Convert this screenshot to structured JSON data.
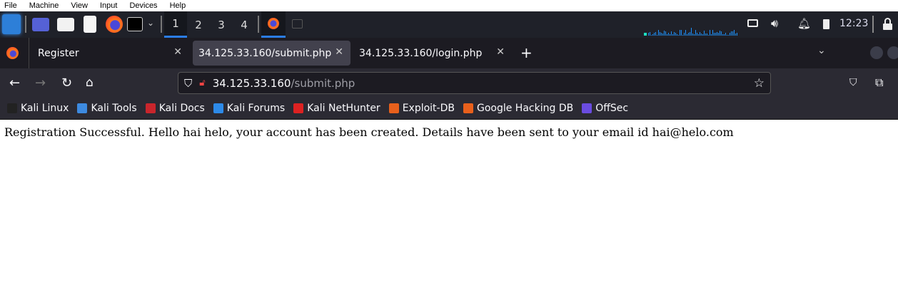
{
  "vm_menu": [
    "File",
    "Machine",
    "View",
    "Input",
    "Devices",
    "Help"
  ],
  "taskbar": {
    "workspaces": [
      "1",
      "2",
      "3",
      "4"
    ],
    "active_workspace": "1",
    "clock": "12:23",
    "accent": "#2b7de9",
    "graph_color": "#1e90ff"
  },
  "tabs": [
    {
      "label": "Register",
      "active": false
    },
    {
      "label": "34.125.33.160/submit.php",
      "active": true
    },
    {
      "label": "34.125.33.160/login.php",
      "active": false
    }
  ],
  "url": {
    "host": "34.125.33.160",
    "path": "/submit.php"
  },
  "bookmarks": [
    {
      "label": "Kali Linux",
      "color": "#222"
    },
    {
      "label": "Kali Tools",
      "color": "#3d8ae0"
    },
    {
      "label": "Kali Docs",
      "color": "#c9252c"
    },
    {
      "label": "Kali Forums",
      "color": "#2d8ae8"
    },
    {
      "label": "Kali NetHunter",
      "color": "#d22"
    },
    {
      "label": "Exploit-DB",
      "color": "#e8601c"
    },
    {
      "label": "Google Hacking DB",
      "color": "#e8601c"
    },
    {
      "label": "OffSec",
      "color": "#6a4ce0"
    }
  ],
  "page": {
    "message": "Registration Successful. Hello hai helo, your account has been created. Details have been sent to your email id hai@helo.com"
  }
}
